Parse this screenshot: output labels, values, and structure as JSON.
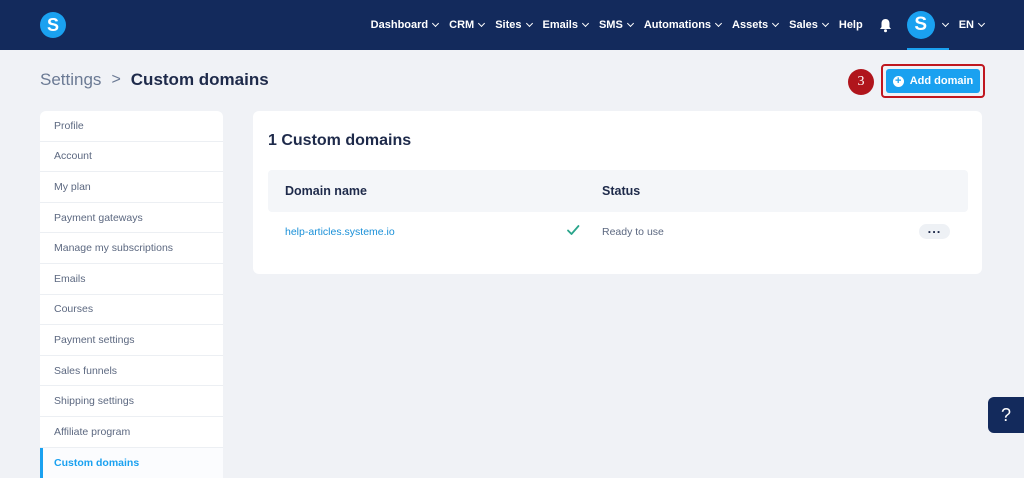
{
  "app": {
    "logo_letter": "S",
    "avatar_letter": "S"
  },
  "nav": {
    "items": [
      {
        "label": "Dashboard",
        "dropdown": true
      },
      {
        "label": "CRM",
        "dropdown": true
      },
      {
        "label": "Sites",
        "dropdown": true
      },
      {
        "label": "Emails",
        "dropdown": true
      },
      {
        "label": "SMS",
        "dropdown": true
      },
      {
        "label": "Automations",
        "dropdown": true
      },
      {
        "label": "Assets",
        "dropdown": true
      },
      {
        "label": "Sales",
        "dropdown": true
      },
      {
        "label": "Help",
        "dropdown": false
      }
    ],
    "icons": {
      "notifications": "bell-icon"
    },
    "language": "EN"
  },
  "breadcrumb": {
    "parent": "Settings",
    "separator": ">",
    "current": "Custom domains"
  },
  "annotation": {
    "step": "3"
  },
  "actions": {
    "add_domain_label": "Add domain"
  },
  "sidebar": {
    "items": [
      {
        "label": "Profile"
      },
      {
        "label": "Account"
      },
      {
        "label": "My plan"
      },
      {
        "label": "Payment gateways"
      },
      {
        "label": "Manage my subscriptions"
      },
      {
        "label": "Emails"
      },
      {
        "label": "Courses"
      },
      {
        "label": "Payment settings"
      },
      {
        "label": "Sales funnels"
      },
      {
        "label": "Shipping settings"
      },
      {
        "label": "Affiliate program"
      },
      {
        "label": "Custom domains",
        "active": true
      }
    ]
  },
  "main": {
    "title": "1 Custom domains",
    "table": {
      "columns": [
        "Domain name",
        "Status"
      ],
      "rows": [
        {
          "domain": "help-articles.systeme.io",
          "status": "Ready to use",
          "status_icon": "check-icon",
          "actions_label": "..."
        }
      ]
    }
  },
  "help": {
    "label": "?"
  },
  "colors": {
    "navbar": "#132a5c",
    "accent": "#1aa1f0",
    "highlight": "#c0171f",
    "success": "#2aa58b"
  }
}
